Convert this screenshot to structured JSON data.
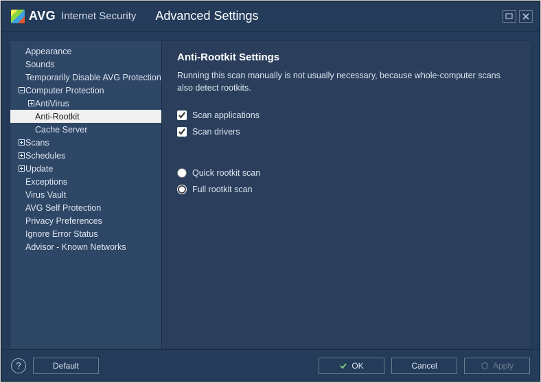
{
  "titlebar": {
    "brand": "AVG",
    "brand_sub": "Internet Security",
    "page_title": "Advanced Settings"
  },
  "sidebar": {
    "items": [
      {
        "label": "Appearance",
        "level": 0,
        "exp": ""
      },
      {
        "label": "Sounds",
        "level": 0,
        "exp": ""
      },
      {
        "label": "Temporarily Disable AVG Protection",
        "level": 0,
        "exp": ""
      },
      {
        "label": "Computer Protection",
        "level": 0,
        "exp": "minus"
      },
      {
        "label": "AntiVirus",
        "level": 1,
        "exp": "plus"
      },
      {
        "label": "Anti-Rootkit",
        "level": 1,
        "exp": "",
        "selected": true
      },
      {
        "label": "Cache Server",
        "level": 1,
        "exp": ""
      },
      {
        "label": "Scans",
        "level": 0,
        "exp": "plus"
      },
      {
        "label": "Schedules",
        "level": 0,
        "exp": "plus"
      },
      {
        "label": "Update",
        "level": 0,
        "exp": "plus"
      },
      {
        "label": "Exceptions",
        "level": 0,
        "exp": ""
      },
      {
        "label": "Virus Vault",
        "level": 0,
        "exp": ""
      },
      {
        "label": "AVG Self Protection",
        "level": 0,
        "exp": ""
      },
      {
        "label": "Privacy Preferences",
        "level": 0,
        "exp": ""
      },
      {
        "label": "Ignore Error Status",
        "level": 0,
        "exp": ""
      },
      {
        "label": "Advisor - Known Networks",
        "level": 0,
        "exp": ""
      }
    ]
  },
  "content": {
    "heading": "Anti-Rootkit Settings",
    "description": "Running this scan manually is not usually necessary, because whole-computer scans also detect rootkits.",
    "checks": [
      {
        "label": "Scan applications",
        "checked": true
      },
      {
        "label": "Scan drivers",
        "checked": true
      }
    ],
    "radios": [
      {
        "label": "Quick rootkit scan",
        "checked": false
      },
      {
        "label": "Full rootkit scan",
        "checked": true
      }
    ]
  },
  "buttons": {
    "default": "Default",
    "ok": "OK",
    "cancel": "Cancel",
    "apply": "Apply"
  }
}
